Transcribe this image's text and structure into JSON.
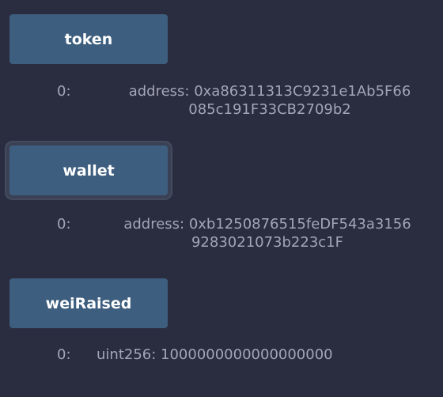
{
  "functions": [
    {
      "button_label": "token",
      "output_index": "0:",
      "output_value": "address: 0xa86311313C9231e1Ab5F66085c191F33CB2709b2"
    },
    {
      "button_label": "wallet",
      "output_index": "0:",
      "output_value": "address: 0xb1250876515feDF543a31569283021073b223c1F"
    },
    {
      "button_label": "weiRaised",
      "output_index": "0:",
      "output_value": "uint256: 1000000000000000000"
    }
  ],
  "colors": {
    "background": "#2a2c3f",
    "button": "#3d5e7e",
    "button_text": "#ffffff",
    "output_text": "#a3a6b6"
  }
}
